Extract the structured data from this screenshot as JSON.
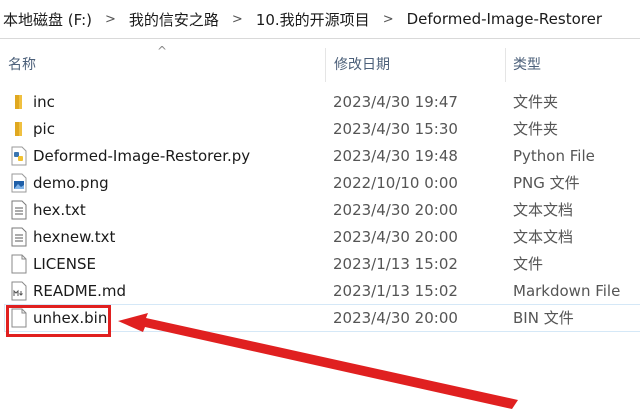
{
  "breadcrumb": [
    "本地磁盘 (F:)",
    "我的信安之路",
    "10.我的开源项目",
    "Deformed-Image-Restorer"
  ],
  "breadcrumb_separator": ">",
  "columns": {
    "name": "名称",
    "date": "修改日期",
    "type": "类型"
  },
  "sort_indicator": "^",
  "files": [
    {
      "name": "inc",
      "date": "2023/4/30 19:47",
      "type": "文件夹",
      "icon": "folder-icon"
    },
    {
      "name": "pic",
      "date": "2023/4/30 15:30",
      "type": "文件夹",
      "icon": "folder-icon"
    },
    {
      "name": "Deformed-Image-Restorer.py",
      "date": "2023/4/30 19:48",
      "type": "Python File",
      "icon": "python-file-icon"
    },
    {
      "name": "demo.png",
      "date": "2022/10/10 0:00",
      "type": "PNG 文件",
      "icon": "image-file-icon"
    },
    {
      "name": "hex.txt",
      "date": "2023/4/30 20:00",
      "type": "文本文档",
      "icon": "text-file-icon"
    },
    {
      "name": "hexnew.txt",
      "date": "2023/4/30 20:00",
      "type": "文本文档",
      "icon": "text-file-icon"
    },
    {
      "name": "LICENSE",
      "date": "2023/1/13 15:02",
      "type": "文件",
      "icon": "blank-file-icon"
    },
    {
      "name": "README.md",
      "date": "2023/1/13 15:02",
      "type": "Markdown File",
      "icon": "markdown-file-icon"
    },
    {
      "name": "unhex.bin",
      "date": "2023/4/30 20:00",
      "type": "BIN 文件",
      "icon": "blank-file-icon"
    }
  ],
  "colors": {
    "folder": "#f0c040",
    "highlight": "#e02020",
    "header_text": "#4c607a",
    "selected_outline": "#d5e8f7"
  }
}
